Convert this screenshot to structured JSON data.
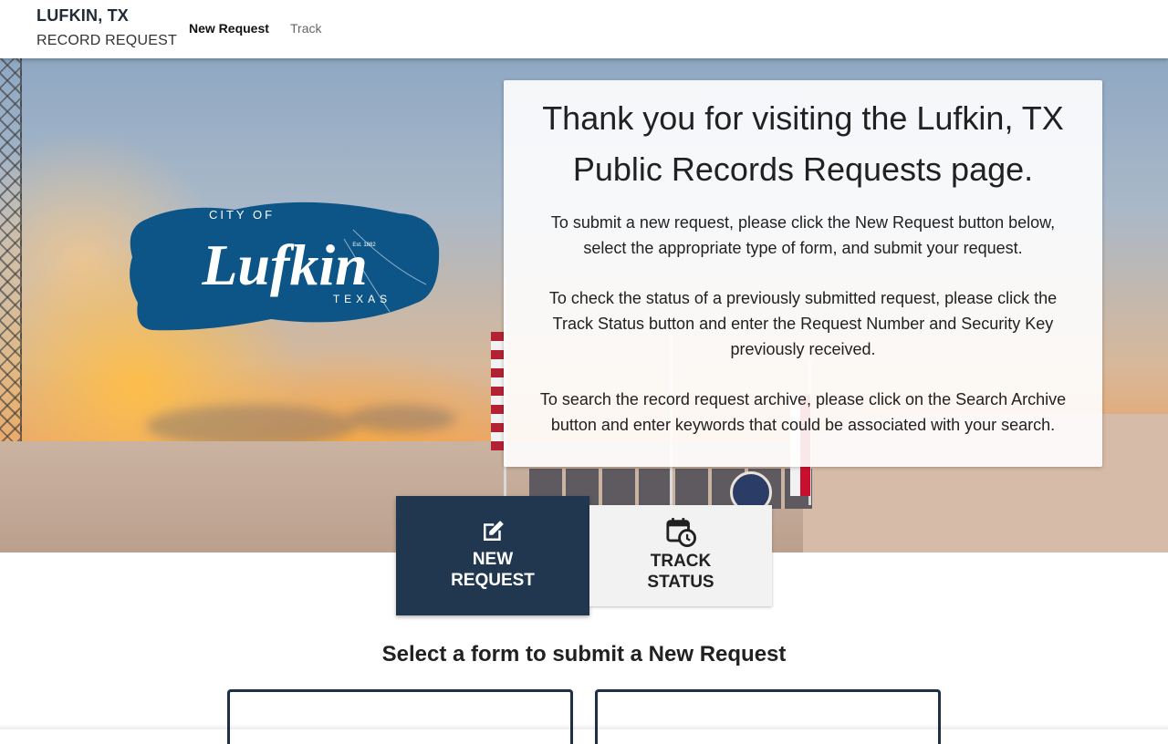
{
  "header": {
    "city": "LUFKIN, TX",
    "subtitle": "RECORD REQUEST",
    "nav": [
      {
        "label": "New Request",
        "active": true
      },
      {
        "label": "Track",
        "active": false
      }
    ]
  },
  "hero": {
    "logo": {
      "top_text": "CITY OF",
      "name": "Lufkin",
      "bottom_text": "TEXAS",
      "est": "Est. 1882",
      "color": "#0d5587"
    },
    "welcome": {
      "title": "Thank you for visiting the Lufkin, TX Public Records Requests page.",
      "paragraphs": [
        "To submit a new request, please click the New Request button below, select the appropriate type of form, and submit your request.",
        "To check the status of a previously submitted request, please click the Track Status button and enter the Request Number and Security Key previously received.",
        "To search the record request archive, please click on the Search Archive button and enter keywords that could be associated with your search."
      ]
    }
  },
  "actions": {
    "new_request": {
      "label": "NEW REQUEST",
      "icon": "edit-icon",
      "selected": true
    },
    "track_status": {
      "label": "TRACK STATUS",
      "icon": "calendar-clock-icon",
      "selected": false
    }
  },
  "section": {
    "title": "Select a form to submit a New Request"
  },
  "colors": {
    "primary_dark": "#21374f",
    "logo_blue": "#0d5587",
    "card_border": "#1e3045"
  }
}
